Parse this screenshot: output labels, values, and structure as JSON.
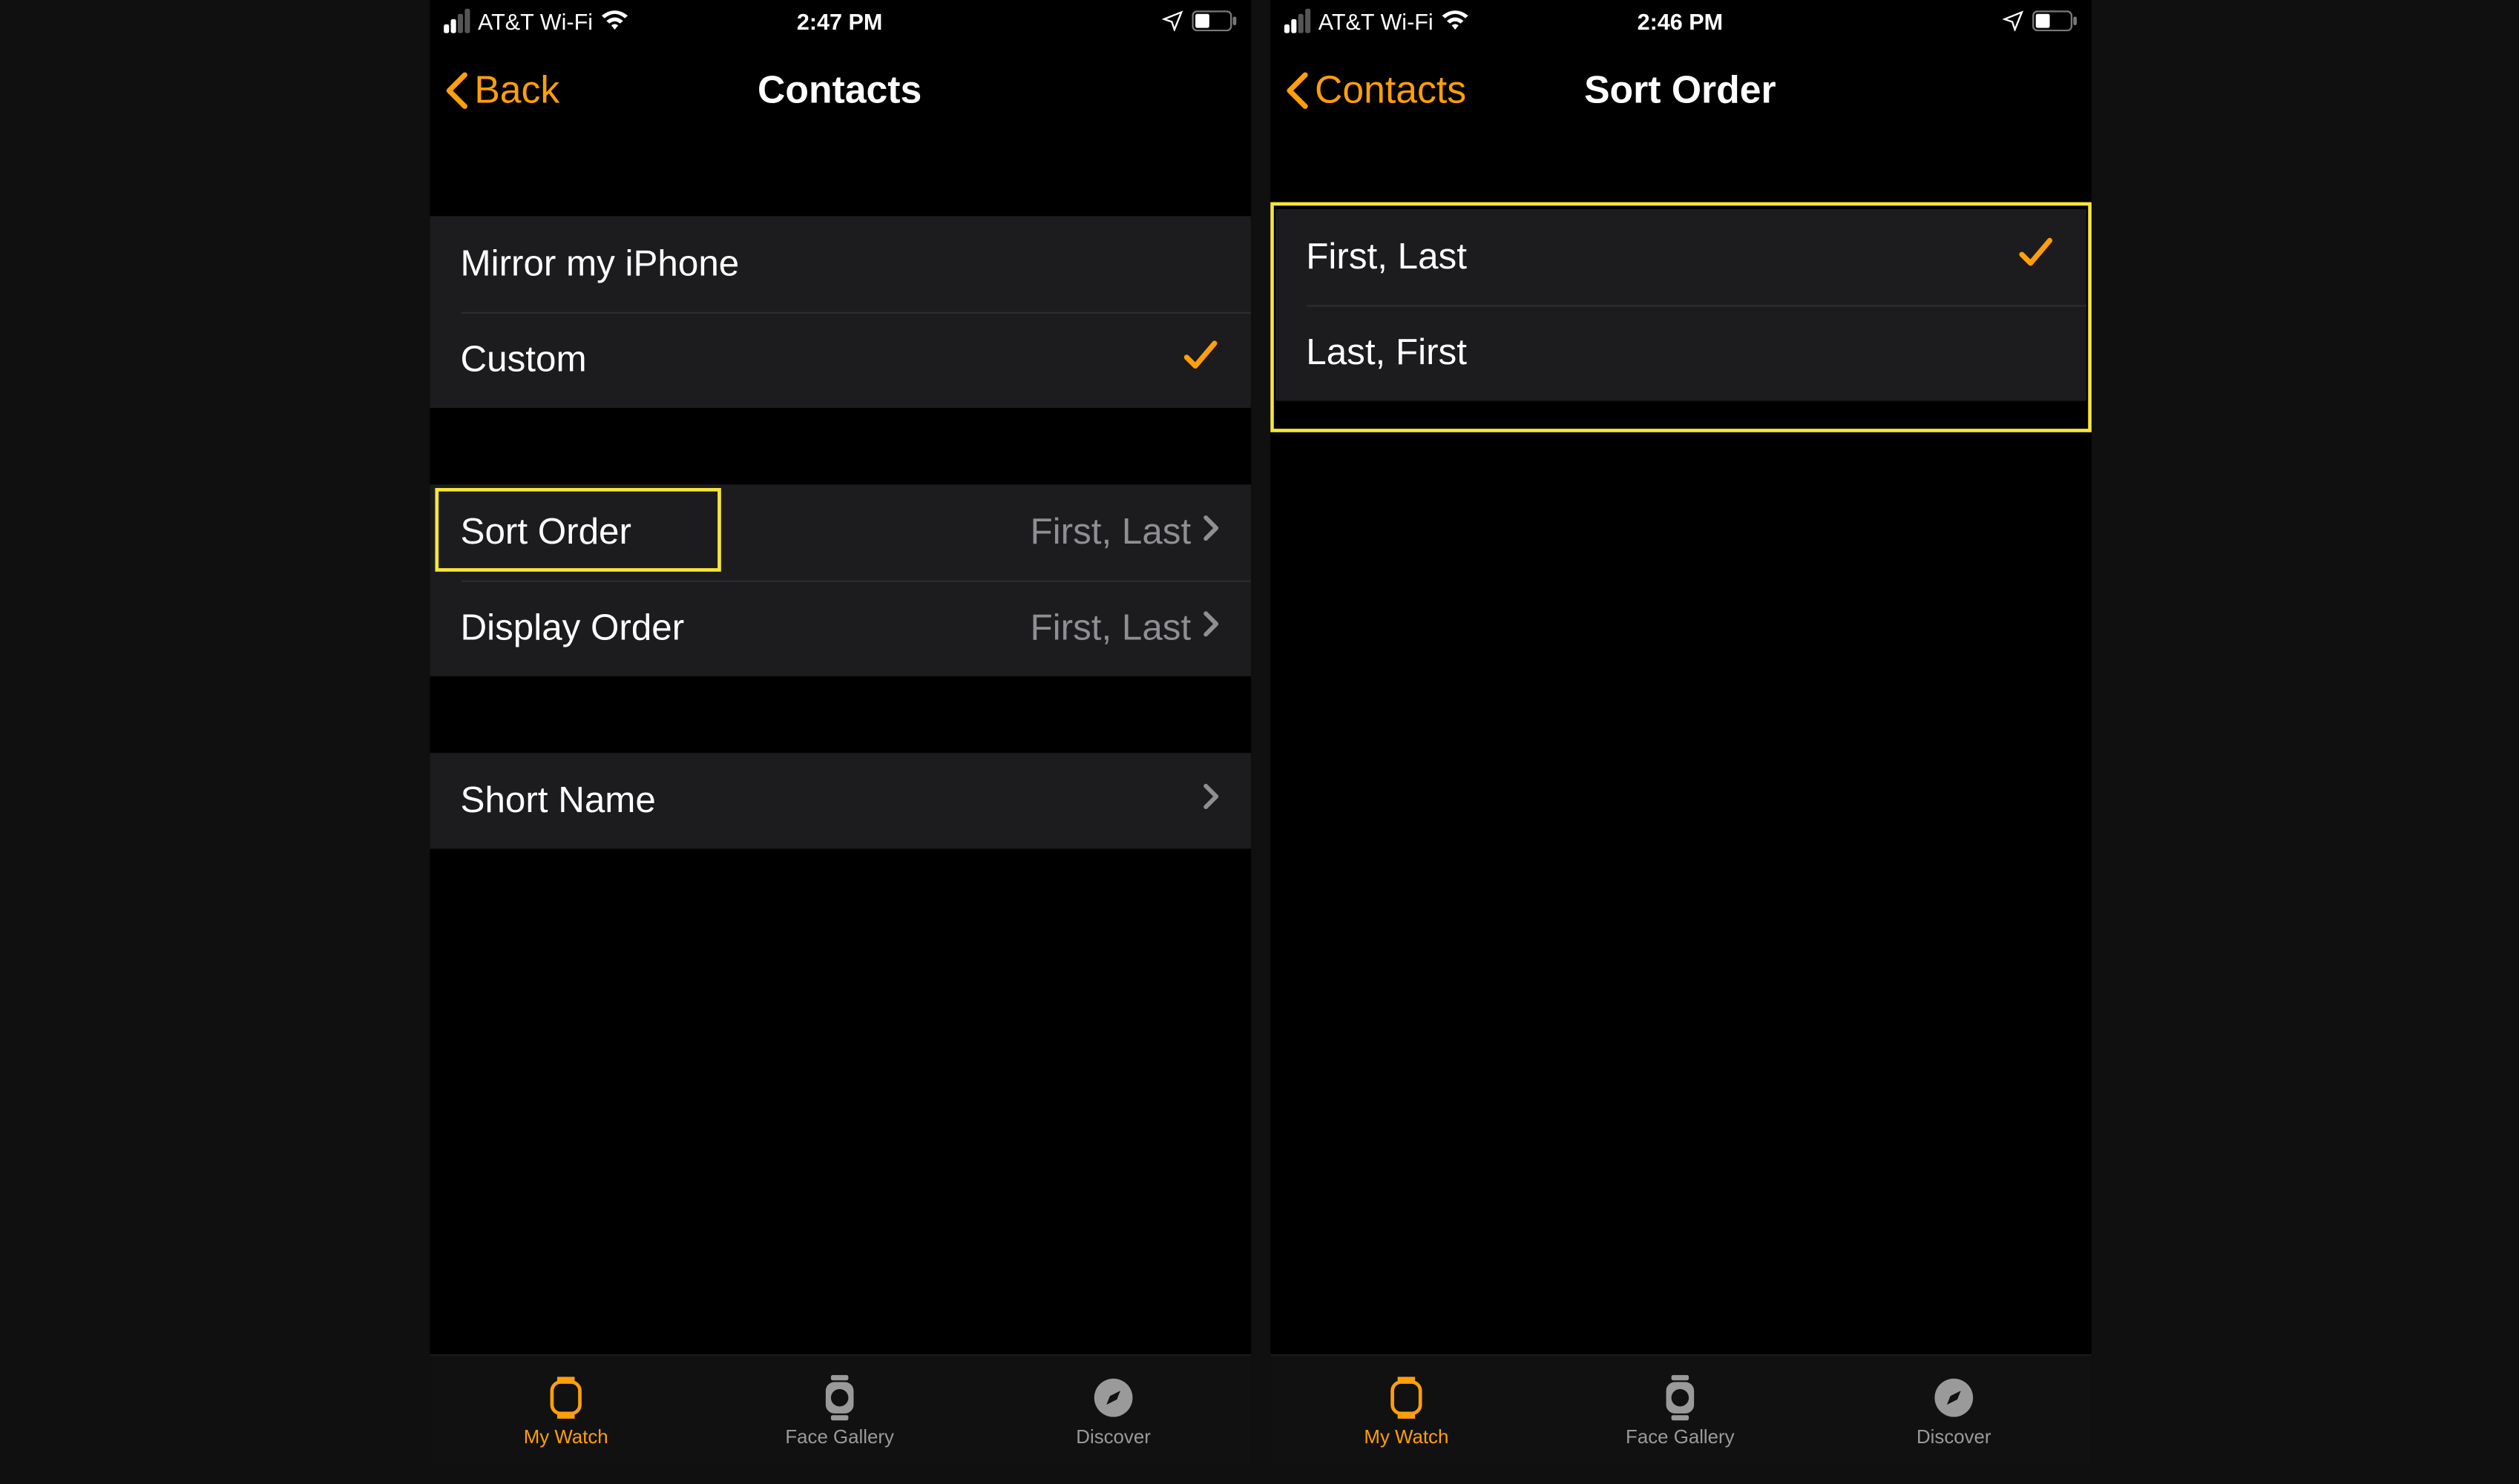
{
  "colors": {
    "accent": "#ff9f0a",
    "bg": "#000000",
    "cell": "#1c1c1e",
    "separator": "#2c2c2e",
    "detail": "#8e8e93",
    "highlight": "#f5e63b"
  },
  "left": {
    "status": {
      "carrier": "AT&T Wi-Fi",
      "time": "2:47 PM"
    },
    "nav": {
      "back": "Back",
      "title": "Contacts"
    },
    "group1": [
      {
        "label": "Mirror my iPhone",
        "selected": false
      },
      {
        "label": "Custom",
        "selected": true
      }
    ],
    "group2": [
      {
        "label": "Sort Order",
        "detail": "First, Last",
        "highlight": true
      },
      {
        "label": "Display Order",
        "detail": "First, Last",
        "highlight": false
      }
    ],
    "group3": [
      {
        "label": "Short Name"
      }
    ],
    "tabs": [
      {
        "label": "My Watch",
        "active": true
      },
      {
        "label": "Face Gallery",
        "active": false
      },
      {
        "label": "Discover",
        "active": false
      }
    ]
  },
  "right": {
    "status": {
      "carrier": "AT&T Wi-Fi",
      "time": "2:46 PM"
    },
    "nav": {
      "back": "Contacts",
      "title": "Sort Order"
    },
    "group1": [
      {
        "label": "First, Last",
        "selected": true
      },
      {
        "label": "Last, First",
        "selected": false
      }
    ],
    "highlight_group": true,
    "tabs": [
      {
        "label": "My Watch",
        "active": true
      },
      {
        "label": "Face Gallery",
        "active": false
      },
      {
        "label": "Discover",
        "active": false
      }
    ]
  }
}
